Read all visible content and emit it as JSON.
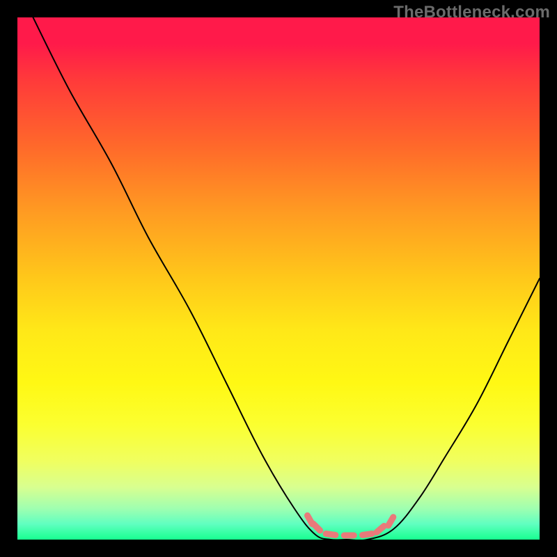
{
  "watermark": "TheBottleneck.com",
  "chart_data": {
    "type": "line",
    "title": "",
    "xlabel": "",
    "ylabel": "",
    "x": [
      0.03,
      0.1,
      0.18,
      0.25,
      0.33,
      0.4,
      0.47,
      0.53,
      0.57,
      0.6,
      0.63,
      0.67,
      0.72,
      0.77,
      0.82,
      0.88,
      0.94,
      1.0
    ],
    "values": [
      1.0,
      0.86,
      0.72,
      0.58,
      0.44,
      0.3,
      0.16,
      0.06,
      0.01,
      0.0,
      0.0,
      0.0,
      0.02,
      0.08,
      0.16,
      0.26,
      0.38,
      0.5
    ],
    "ylim": [
      0,
      1
    ],
    "xlim": [
      0,
      1
    ],
    "annotations": {
      "dashed_marks": [
        {
          "x": 0.56,
          "y": 0.962
        },
        {
          "x": 0.573,
          "y": 0.976
        },
        {
          "x": 0.6,
          "y": 0.99
        },
        {
          "x": 0.635,
          "y": 0.992
        },
        {
          "x": 0.67,
          "y": 0.99
        },
        {
          "x": 0.695,
          "y": 0.98
        },
        {
          "x": 0.715,
          "y": 0.965
        }
      ]
    },
    "colors": {
      "curve": "#000000",
      "dashes": "#e97a7a",
      "gradient_top": "#ff1a4a",
      "gradient_bottom": "#18ff90"
    }
  }
}
